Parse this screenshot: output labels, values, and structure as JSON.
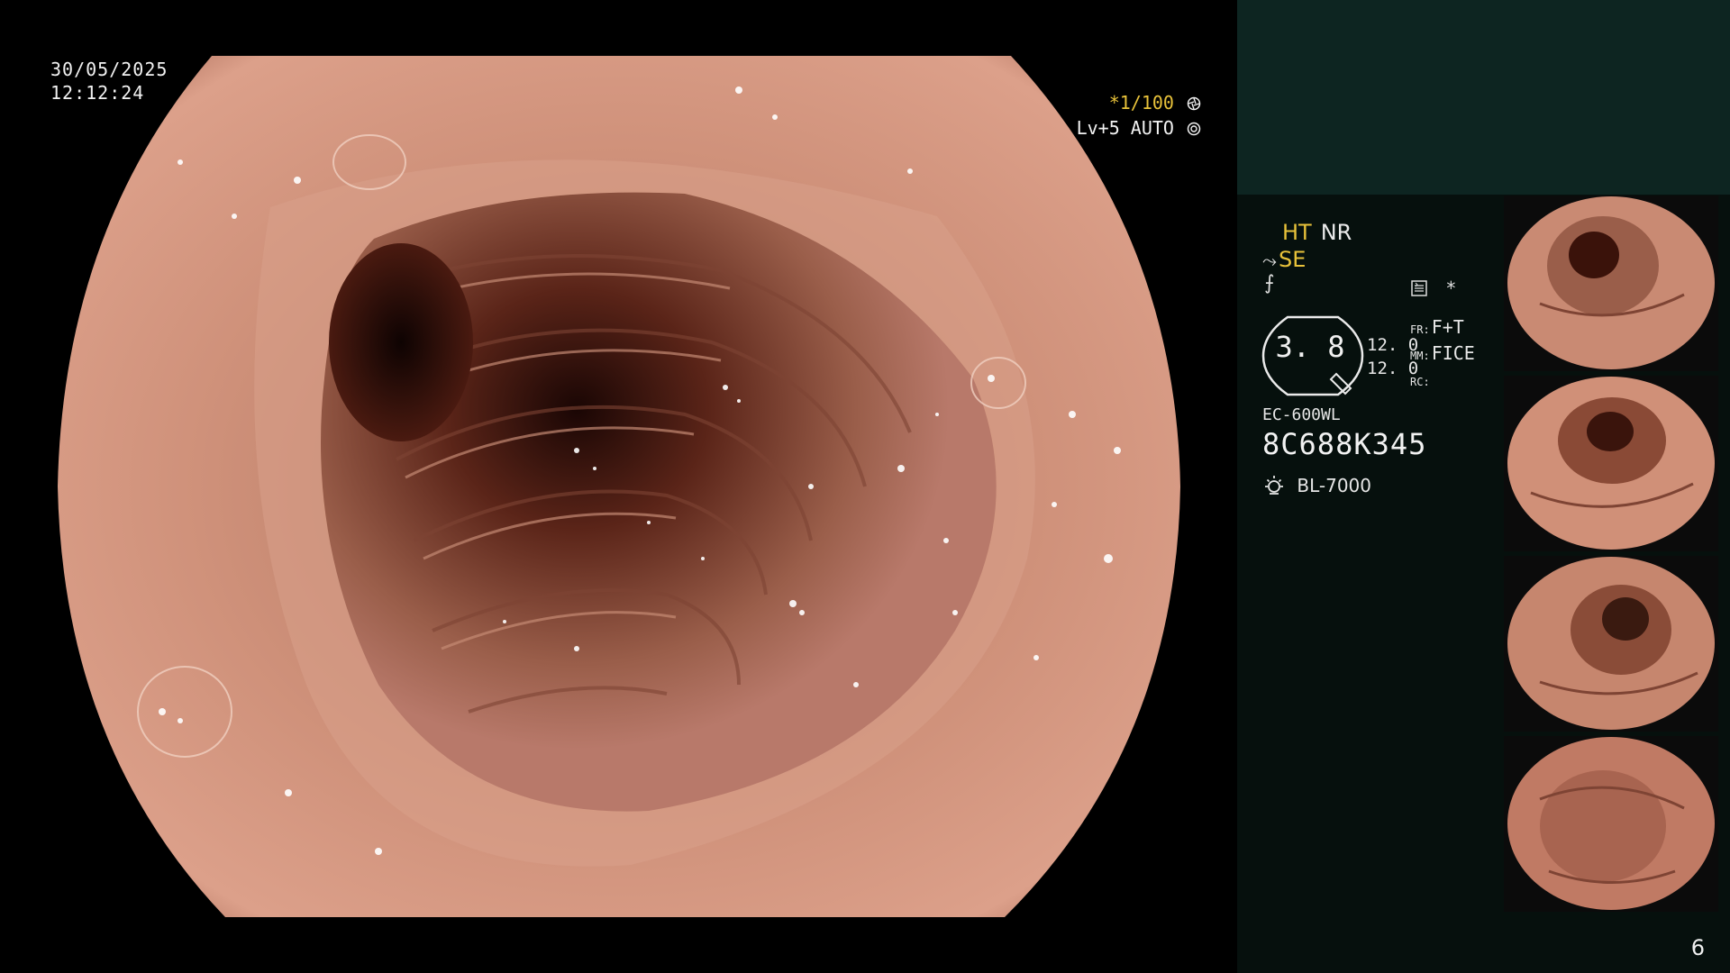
{
  "osd": {
    "date": "30/05/2025",
    "time": "12:12:24",
    "shutter": "*1/100",
    "iris": "Lv+5 AUTO"
  },
  "panel": {
    "ht": "HT",
    "nr": "NR",
    "se": "SE",
    "se_glyph": "⤳",
    "f_glyph": "⨍",
    "asterisk": "*",
    "gauge_value": "3. 8",
    "gauge_num_1": "12. 0",
    "gauge_num_2": "12. 0",
    "fr_label": "FR:",
    "fr_value": "F+T",
    "mm_label": "MM:",
    "mm_value": "FICE",
    "rc_label": "RC:",
    "rc_value": "",
    "scope_model": "EC-600WL",
    "scope_serial": "8C688K345",
    "light_source": "BL-7000"
  },
  "page_number": "6",
  "colors": {
    "mucosa": "#c98a73",
    "lumen_dark": "#2a0d08",
    "panel_bg": "#06100d",
    "panel_top": "#0d2521",
    "osd_yellow": "#e8c23a"
  },
  "icons": {
    "shutter_icon": "aperture-icon",
    "iris_icon": "iris-icon",
    "memo_icon": "memo-icon",
    "lamp_icon": "lamp-icon"
  }
}
